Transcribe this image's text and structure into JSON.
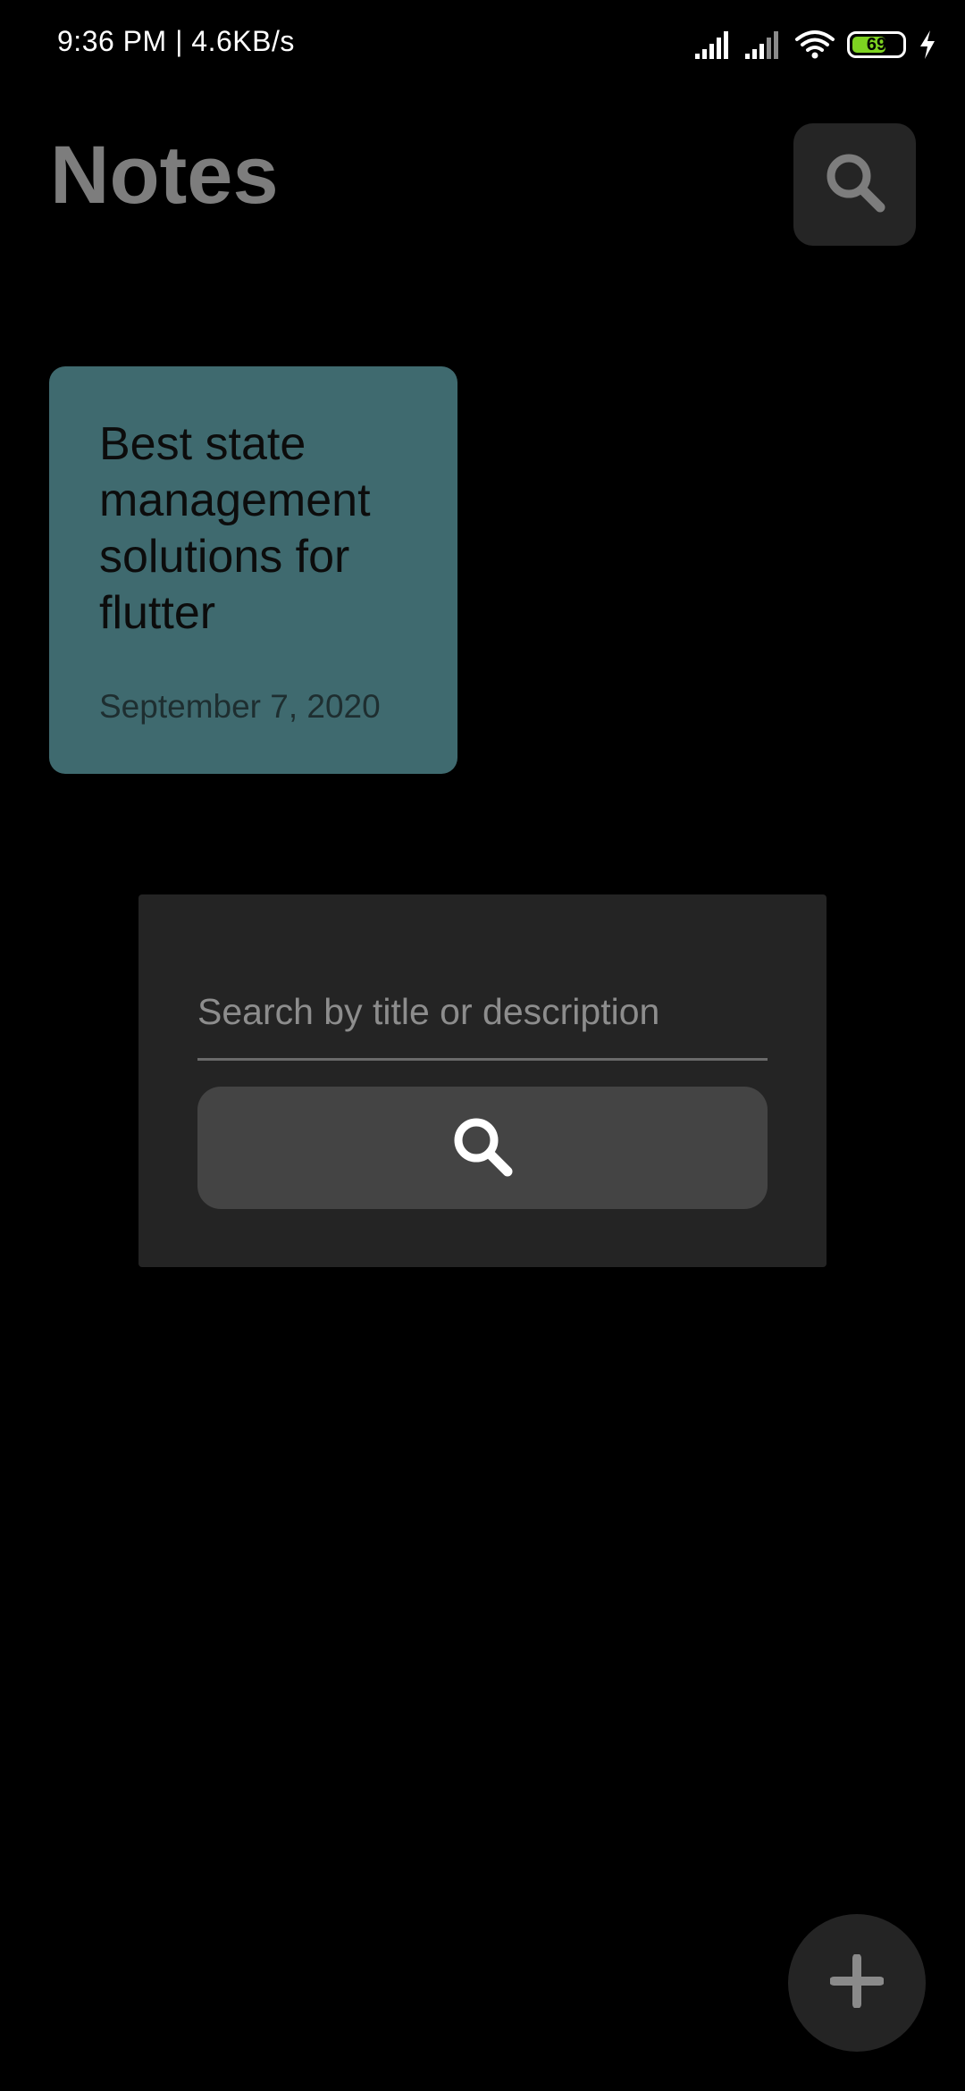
{
  "status_bar": {
    "time_speed": "9:36 PM | 4.6KB/s",
    "battery_level": "69",
    "battery_percent": 69,
    "battery_color": "#7ed321",
    "icons": [
      "signal-icon",
      "signal-icon",
      "wifi-icon",
      "battery-icon",
      "charging-icon"
    ]
  },
  "header": {
    "title": "Notes",
    "search_button_icon": "search-icon"
  },
  "notes": [
    {
      "title": "Best state management solutions for flutter",
      "date": "September 7, 2020",
      "color": "#3f6a6f"
    }
  ],
  "search_dialog": {
    "placeholder": "Search by title or description",
    "value": "",
    "submit_icon": "search-icon"
  },
  "fab": {
    "icon": "plus-icon"
  },
  "colors": {
    "background": "#000000",
    "title": "#7d7d7d",
    "panel": "#242424",
    "button": "#444444"
  }
}
